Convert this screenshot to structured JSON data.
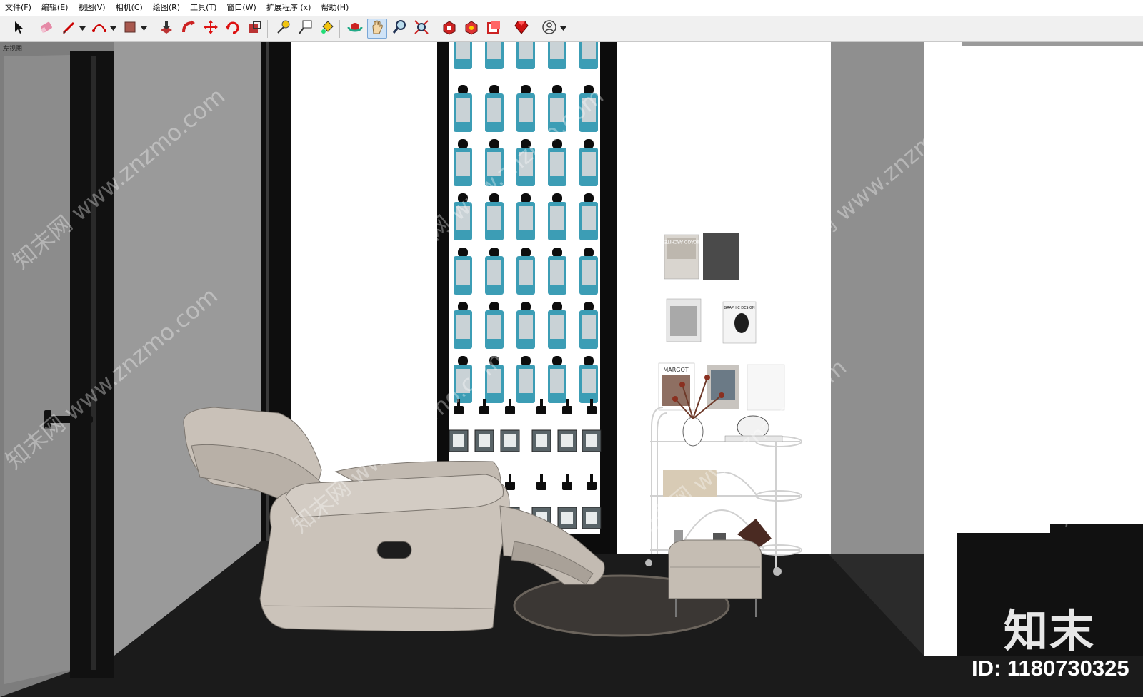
{
  "menu": {
    "items": [
      {
        "label": "文件(F)"
      },
      {
        "label": "编辑(E)"
      },
      {
        "label": "视图(V)"
      },
      {
        "label": "相机(C)"
      },
      {
        "label": "绘图(R)"
      },
      {
        "label": "工具(T)"
      },
      {
        "label": "窗口(W)"
      },
      {
        "label": "扩展程序 (x)"
      },
      {
        "label": "帮助(H)"
      }
    ]
  },
  "toolbar": {
    "tools": [
      {
        "icon": "select-arrow-icon"
      },
      {
        "icon": "eraser-icon"
      },
      {
        "icon": "pencil-line-icon",
        "dropdown": true
      },
      {
        "icon": "arc-icon",
        "dropdown": true
      },
      {
        "icon": "rectangle-icon",
        "dropdown": true
      },
      {
        "icon": "push-pull-icon"
      },
      {
        "icon": "follow-me-icon"
      },
      {
        "icon": "move-icon"
      },
      {
        "icon": "rotate-icon"
      },
      {
        "icon": "offset-icon"
      },
      {
        "icon": "tape-measure-icon"
      },
      {
        "icon": "text-label-icon"
      },
      {
        "icon": "paint-bucket-icon"
      },
      {
        "icon": "orbit-icon"
      },
      {
        "icon": "pan-hand-icon",
        "active": true
      },
      {
        "icon": "zoom-icon"
      },
      {
        "icon": "zoom-extents-icon"
      },
      {
        "icon": "3d-warehouse-icon"
      },
      {
        "icon": "extension-warehouse-icon"
      },
      {
        "icon": "send-to-layout-icon"
      },
      {
        "icon": "ruby-console-icon"
      },
      {
        "icon": "account-user-icon",
        "dropdown": true
      }
    ]
  },
  "viewport": {
    "view_label": "左视图",
    "poster_titles": [
      "CHICAGO ARCHITECT",
      "GRAPHIC DESIGN",
      "MARGOT"
    ]
  },
  "watermark": {
    "brand": "知末",
    "id_text": "ID: 1180730325",
    "site": "知末网 www.znzmo.com"
  },
  "colors": {
    "accent_active": "#cfe3f7",
    "floor": "#1b1b1b",
    "wall_grey": "#8a8a8a",
    "bottle_blue": "#3c9db5",
    "sofa": "#c9c1b8"
  }
}
